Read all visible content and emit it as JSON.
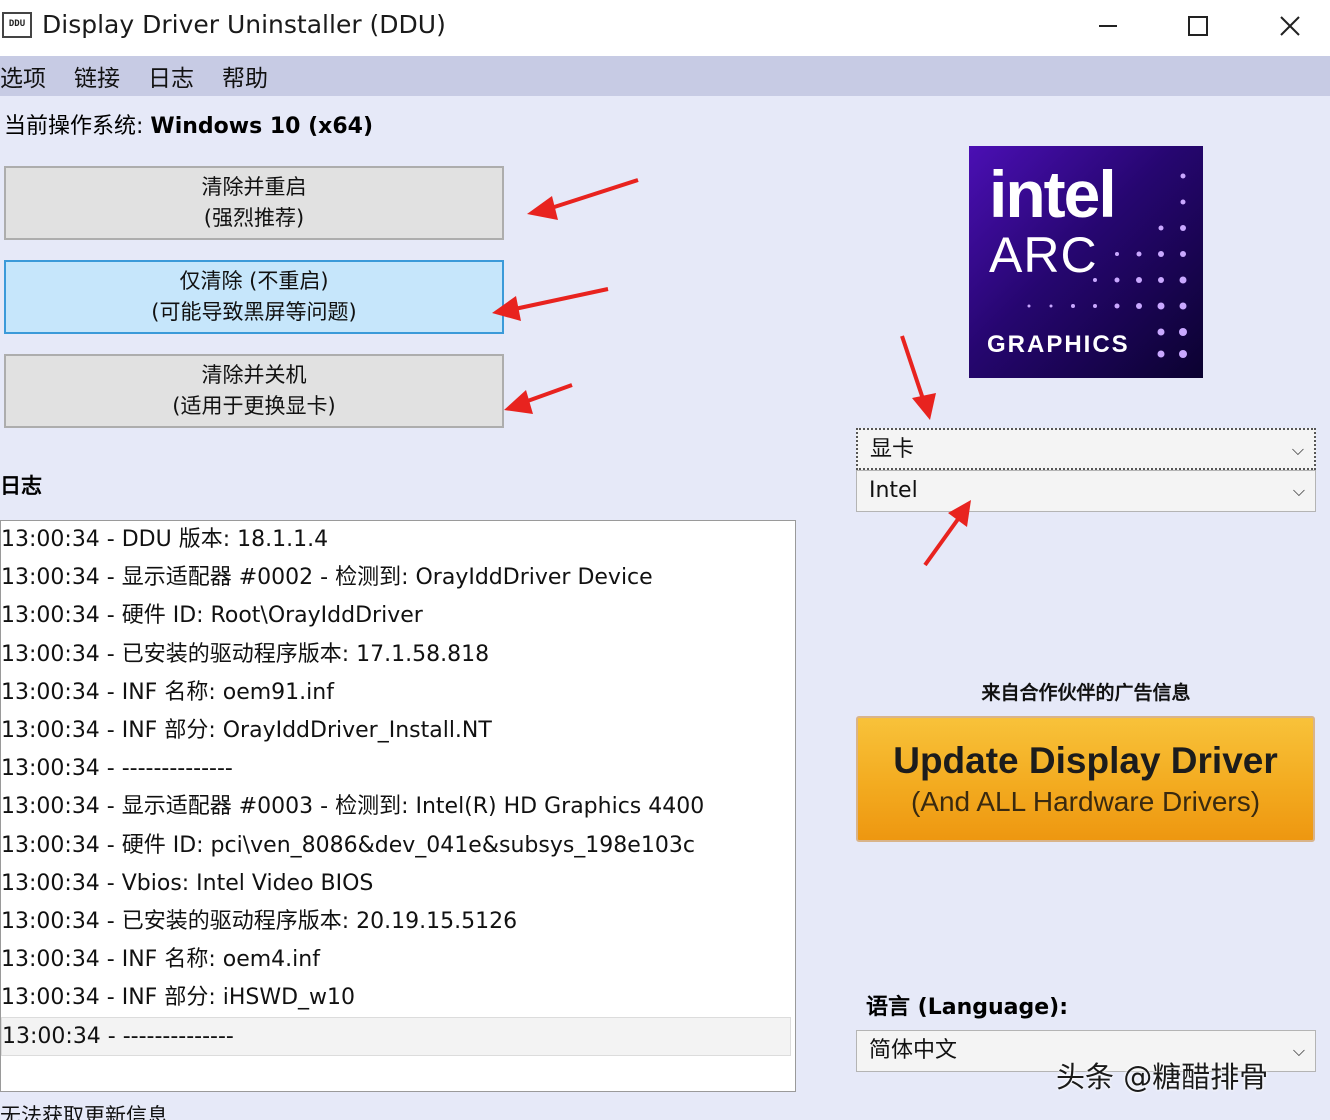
{
  "window": {
    "icon_text": "DDU",
    "title": "Display Driver Uninstaller (DDU)"
  },
  "menu": {
    "items": [
      {
        "label": "选项"
      },
      {
        "label": "链接"
      },
      {
        "label": "日志"
      },
      {
        "label": "帮助"
      }
    ]
  },
  "os": {
    "label": "当前操作系统:",
    "value": "Windows 10 (x64)"
  },
  "actions": [
    {
      "line1": "清除并重启",
      "line2": "(强烈推荐)"
    },
    {
      "line1": "仅清除 (不重启)",
      "line2": "(可能导致黑屏等问题)"
    },
    {
      "line1": "清除并关机",
      "line2": "(适用于更换显卡)"
    }
  ],
  "log": {
    "label": "日志",
    "lines": [
      "13:00:34 - DDU 版本: 18.1.1.4",
      "13:00:34 - 显示适配器 #0002 - 检测到: OrayIddDriver Device",
      "13:00:34 - 硬件 ID: Root\\OrayIddDriver",
      "13:00:34 - 已安装的驱动程序版本: 17.1.58.818",
      "13:00:34 - INF 名称: oem91.inf",
      "13:00:34 - INF 部分: OrayIddDriver_Install.NT",
      "13:00:34 - --------------",
      "13:00:34 - 显示适配器 #0003 - 检测到: Intel(R) HD Graphics 4400",
      "13:00:34 - 硬件 ID: pci\\ven_8086&dev_041e&subsys_198e103c",
      "13:00:34 - Vbios: Intel Video BIOS",
      "13:00:34 - 已安装的驱动程序版本: 20.19.15.5126",
      "13:00:34 - INF 名称: oem4.inf",
      "13:00:34 - INF 部分: iHSWD_w10",
      "13:00:34 - --------------"
    ]
  },
  "status": "无法获取更新信息",
  "logo": {
    "line1": "intel",
    "line2": "ARC",
    "line3": "GRAPHICS",
    "gradient_start": "#4b0fb4",
    "gradient_end": "#0b0230"
  },
  "device_type": {
    "selected": "显卡"
  },
  "vendor": {
    "selected": "Intel"
  },
  "ad": {
    "label": "来自合作伙伴的广告信息",
    "main": "Update Display Driver",
    "sub": "(And ALL Hardware Drivers)",
    "color": "#f3ab20"
  },
  "language": {
    "label": "语言 (Language):",
    "selected": "简体中文"
  },
  "watermark": "头条 @糖醋排骨",
  "colors": {
    "annotation_arrow": "#e8231f",
    "menubar": "#c7cbe4",
    "selected_button": "#c6e6fb"
  }
}
